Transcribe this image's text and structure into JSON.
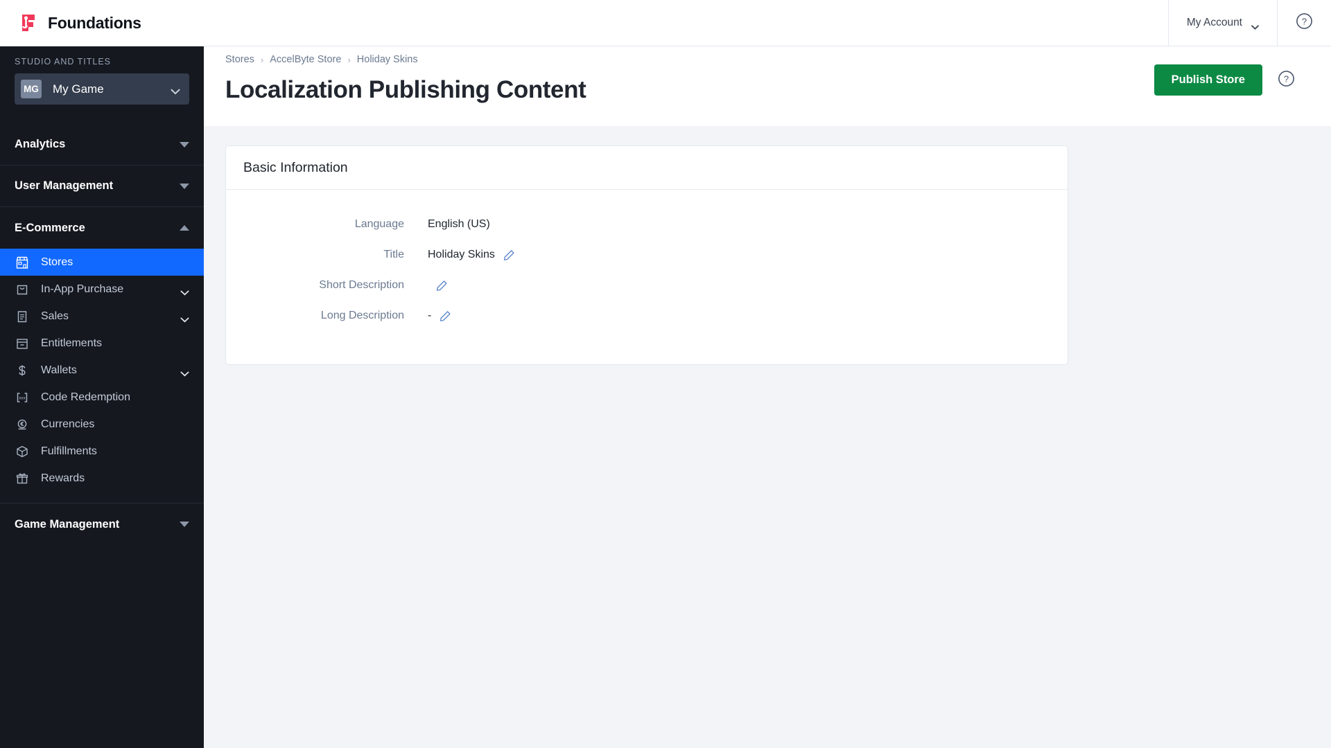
{
  "topbar": {
    "brand_name": "Foundations",
    "logo_color": "#f2385a",
    "account_label": "My Account",
    "help_icon": "question-circle-icon",
    "chevron_icon": "chevron-down-icon"
  },
  "sidebar": {
    "studio_label": "STUDIO AND TITLES",
    "game": {
      "initials": "MG",
      "name": "My Game"
    },
    "sections": [
      {
        "label": "Analytics",
        "expanded": false,
        "arrow": "triangle-down-icon"
      },
      {
        "label": "User Management",
        "expanded": false,
        "arrow": "triangle-down-icon"
      },
      {
        "label": "E-Commerce",
        "expanded": true,
        "arrow": "triangle-up-icon"
      }
    ],
    "items": [
      {
        "label": "Stores",
        "icon": "storefront-icon",
        "active": true,
        "expandable": false
      },
      {
        "label": "In-App Purchase",
        "icon": "shopping-bag-icon",
        "active": false,
        "expandable": true
      },
      {
        "label": "Sales",
        "icon": "receipt-icon",
        "active": false,
        "expandable": true
      },
      {
        "label": "Entitlements",
        "icon": "archive-box-icon",
        "active": false,
        "expandable": false
      },
      {
        "label": "Wallets",
        "icon": "dollar-sign-icon",
        "active": false,
        "expandable": true
      },
      {
        "label": "Code Redemption",
        "icon": "code-brackets-icon",
        "active": false,
        "expandable": false
      },
      {
        "label": "Currencies",
        "icon": "euro-coin-icon",
        "active": false,
        "expandable": false
      },
      {
        "label": "Fulfillments",
        "icon": "package-box-icon",
        "active": false,
        "expandable": false
      },
      {
        "label": "Rewards",
        "icon": "gift-icon",
        "active": false,
        "expandable": false
      }
    ],
    "bottom_section": {
      "label": "Game Management",
      "arrow": "triangle-down-icon"
    },
    "active_color": "#1269ff",
    "background_color": "#15181f"
  },
  "main": {
    "breadcrumb": [
      {
        "label": "Stores"
      },
      {
        "label": "AccelByte Store"
      },
      {
        "label": "Holiday Skins"
      }
    ],
    "breadcrumb_separator": "›",
    "page_title": "Localization Publishing Content",
    "publish_button": "Publish Store",
    "publish_button_color": "#0c8a44",
    "help_icon": "question-circle-icon",
    "card": {
      "title": "Basic Information",
      "rows": [
        {
          "label": "Language",
          "value": "English (US)",
          "editable": false
        },
        {
          "label": "Title",
          "value": "Holiday Skins",
          "editable": true
        },
        {
          "label": "Short Description",
          "value": "",
          "editable": true
        },
        {
          "label": "Long Description",
          "value": "-",
          "editable": true
        }
      ]
    }
  }
}
